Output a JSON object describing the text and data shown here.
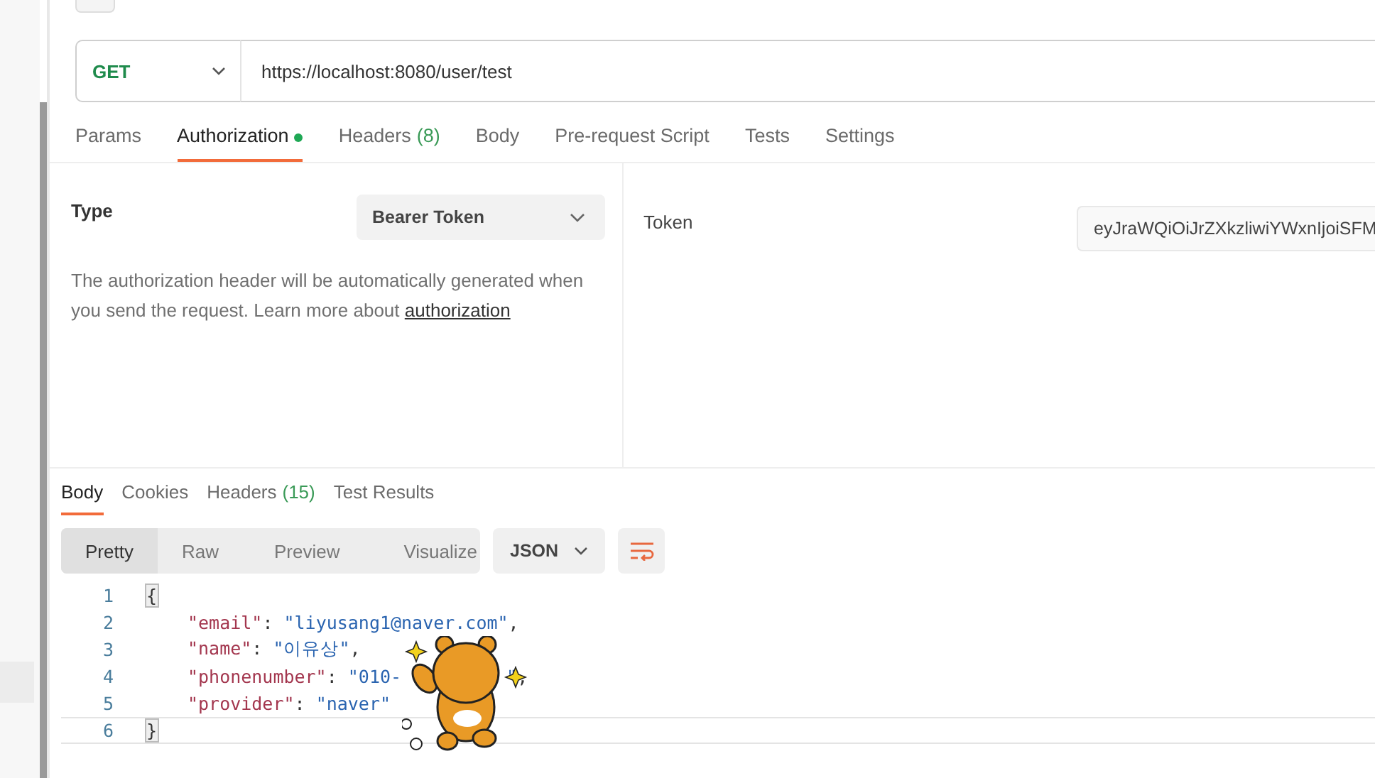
{
  "request": {
    "method": "GET",
    "url": "https://localhost:8080/user/test"
  },
  "request_tabs": [
    {
      "label": "Params",
      "selected": false
    },
    {
      "label": "Authorization",
      "selected": true,
      "dot": true
    },
    {
      "label": "Headers",
      "count": "(8)",
      "selected": false
    },
    {
      "label": "Body",
      "selected": false
    },
    {
      "label": "Pre-request Script",
      "selected": false
    },
    {
      "label": "Tests",
      "selected": false
    },
    {
      "label": "Settings",
      "selected": false
    }
  ],
  "auth": {
    "type_label": "Type",
    "type_value": "Bearer Token",
    "description": "The authorization header will be automatically generated when you send the request. Learn more about",
    "link": "authorization",
    "token_label": "Token",
    "token_value": "eyJraWQiOiJrZXkzliwiYWxnIjoiSFM"
  },
  "response_tabs": [
    {
      "label": "Body",
      "selected": true
    },
    {
      "label": "Cookies",
      "selected": false
    },
    {
      "label": "Headers",
      "count": "(15)",
      "selected": false
    },
    {
      "label": "Test Results",
      "selected": false
    }
  ],
  "view_modes": [
    {
      "label": "Pretty",
      "selected": true
    },
    {
      "label": "Raw",
      "selected": false
    },
    {
      "label": "Preview",
      "selected": false
    },
    {
      "label": "Visualize",
      "selected": false
    }
  ],
  "format": "JSON",
  "code_lines": [
    {
      "number": "1",
      "current": false,
      "tokens": [
        {
          "kind": "bracket",
          "text": "{"
        }
      ]
    },
    {
      "number": "2",
      "current": false,
      "tokens": [
        {
          "kind": "key",
          "text": "\"email\""
        },
        {
          "kind": "punct",
          "text": ": "
        },
        {
          "kind": "string",
          "text": "\"liyusang1@naver.com\""
        },
        {
          "kind": "punct",
          "text": ","
        }
      ]
    },
    {
      "number": "3",
      "current": false,
      "tokens": [
        {
          "kind": "key",
          "text": "\"name\""
        },
        {
          "kind": "punct",
          "text": ": "
        },
        {
          "kind": "string",
          "text": "\"이유상\""
        },
        {
          "kind": "punct",
          "text": ","
        }
      ]
    },
    {
      "number": "4",
      "current": false,
      "tokens": [
        {
          "kind": "key",
          "text": "\"phonenumber\""
        },
        {
          "kind": "punct",
          "text": ": "
        },
        {
          "kind": "string",
          "text": "\"010-"
        },
        {
          "kind": "covered"
        },
        {
          "kind": "string",
          "text": "\""
        },
        {
          "kind": "punct",
          "text": ","
        }
      ]
    },
    {
      "number": "5",
      "current": false,
      "tokens": [
        {
          "kind": "key",
          "text": "\"provider\""
        },
        {
          "kind": "punct",
          "text": ": "
        },
        {
          "kind": "string",
          "text": "\"naver\""
        }
      ]
    },
    {
      "number": "6",
      "current": true,
      "tokens": [
        {
          "kind": "bracket",
          "text": "}"
        }
      ]
    }
  ]
}
